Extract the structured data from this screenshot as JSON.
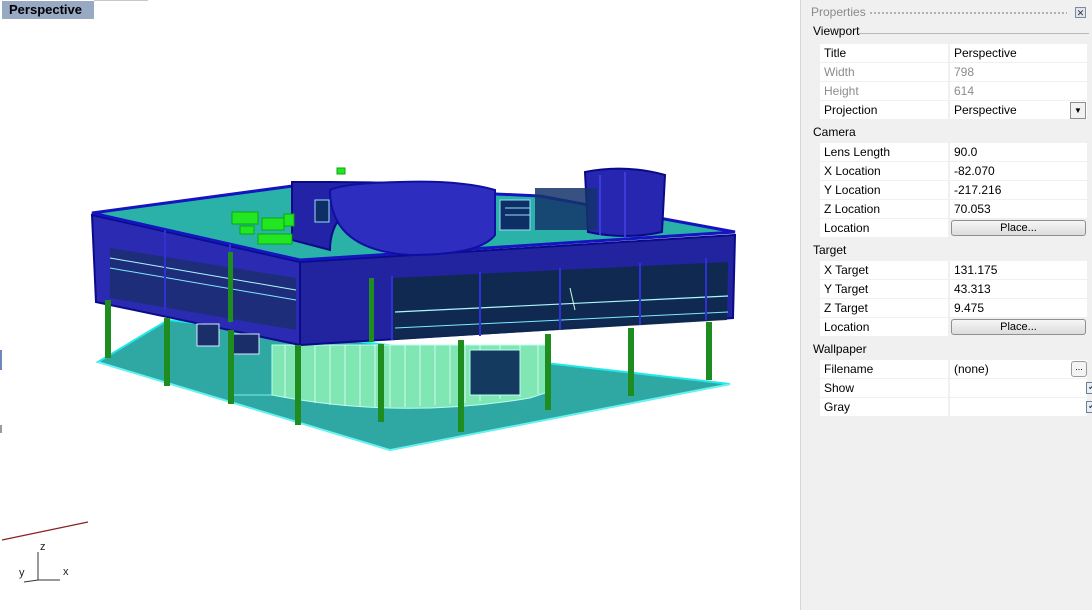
{
  "viewport": {
    "title": "Perspective",
    "axes": {
      "z": "z",
      "y": "y",
      "x": "x"
    }
  },
  "properties": {
    "title": "Properties",
    "close_icon": "close-icon",
    "sections": {
      "viewport": {
        "label": "Viewport",
        "title_label": "Title",
        "title_value": "Perspective",
        "width_label": "Width",
        "width_value": "798",
        "height_label": "Height",
        "height_value": "614",
        "projection_label": "Projection",
        "projection_value": "Perspective"
      },
      "camera": {
        "label": "Camera",
        "lens_label": "Lens Length",
        "lens_value": "90.0",
        "x_label": "X Location",
        "x_value": "-82.070",
        "y_label": "Y Location",
        "y_value": "-217.216",
        "z_label": "Z Location",
        "z_value": "70.053",
        "location_label": "Location",
        "place_button": "Place..."
      },
      "target": {
        "label": "Target",
        "x_label": "X Target",
        "x_value": "131.175",
        "y_label": "Y Target",
        "y_value": "43.313",
        "z_label": "Z Target",
        "z_value": "9.475",
        "location_label": "Location",
        "place_button": "Place..."
      },
      "wallpaper": {
        "label": "Wallpaper",
        "filename_label": "Filename",
        "filename_value": "(none)",
        "browse_button": "...",
        "show_label": "Show",
        "show_checked": true,
        "gray_label": "Gray",
        "gray_checked": true
      }
    }
  },
  "colors": {
    "title_tab": "#98a9c4",
    "building_blue": "#1a1aa8",
    "ground_cyan": "#33b7b3",
    "columns_green": "#1e8c1e",
    "highlight_green": "#22e622"
  }
}
